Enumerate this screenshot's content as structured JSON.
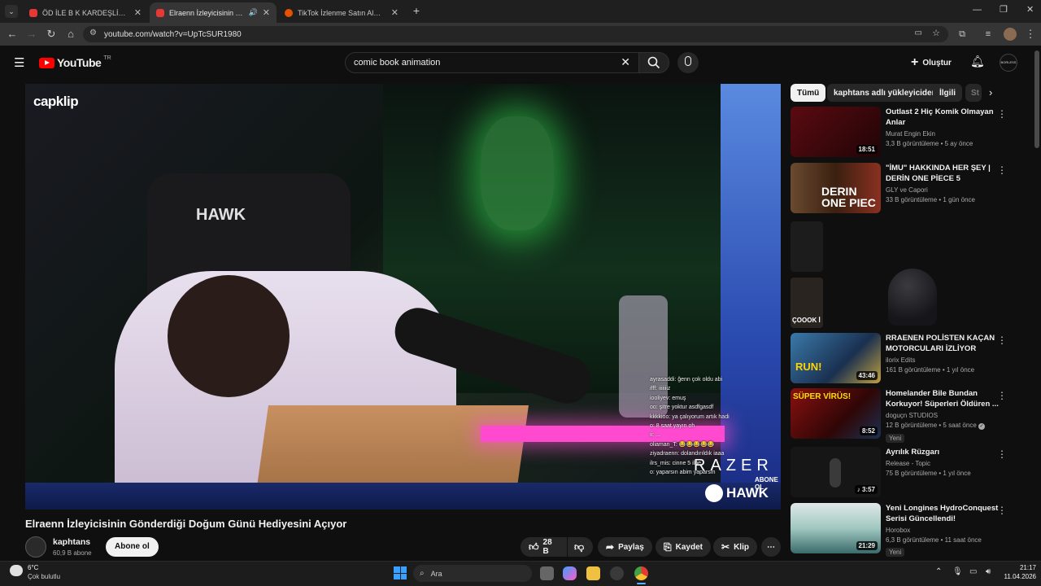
{
  "browser": {
    "tabs": [
      {
        "title": "ÖD İLE B K KARDEŞLİĞİ! OUTLA",
        "active": false,
        "color": "#e53935"
      },
      {
        "title": "Elraenn İzleyicisinin Gönder",
        "active": true,
        "color": "#e53935"
      },
      {
        "title": "TikTok İzlenme Satın Alma Den",
        "active": false,
        "color": "#e65100"
      }
    ],
    "new_tab": "+",
    "url": "youtube.com/watch?v=UpTcSUR1980"
  },
  "youtube": {
    "logo_text": "YouTube",
    "region": "TR",
    "search_value": "comic book animation",
    "create_label": "Oluştur",
    "avatar_text": "BORLESS"
  },
  "video": {
    "title": "Elraenn İzleyicisinin Gönderdiği Doğum Günü Hediyesini Açıyor",
    "channel_name": "kaphtans",
    "subscribers": "60,9 B abone",
    "subscribe_label": "Abone ol",
    "likes": "28 B",
    "share_label": "Paylaş",
    "save_label": "Kaydet",
    "clip_label": "Klip",
    "watermark": "capklip",
    "overlay_brand": "RAZER",
    "overlay_sub": "ABONE OL",
    "chat_lines": [
      "ayrasaddi: ğenn çok oldu abi",
      "ifff: iiiiiiiz",
      "iooliyev: emuş",
      "oo: şitre yoktur asdfgasdf",
      "kkkkioo: ya çalıyorum artık hadi",
      "o: 8 saat yayın oh",
      "ii: ...",
      "oliaman_T: 😂😂😂😂😂",
      "ziyadraenn: dolandırıldık iaaa",
      "ilrs_mis: cinne 5 ilne",
      "o: yaparsın abim yaparsın"
    ]
  },
  "chips": [
    "Tümü",
    "kaphtans adlı yükleyiciden",
    "İlgili",
    "St"
  ],
  "recommendations": [
    {
      "title": "Outlast 2   Hiç Komik Olmayan Anlar",
      "channel": "Murat Engin Ekin",
      "meta": "3,3 B görüntüleme • 5 ay önce",
      "duration": "18:51",
      "badge": "",
      "color": "#3a0a0e"
    },
    {
      "title": "\"İMU\" HAKKINDA HER ŞEY | DERİN ONE PİECE 5",
      "channel": "GLY ve Capori",
      "meta": "33 B görüntüleme • 1 gün önce",
      "duration": "",
      "badge": "",
      "color": "#4a3020"
    },
    {
      "title": "RRAENEN POLİSTEN KAÇAN MOTORCULARI İZLİYOR",
      "channel": "ilorix Edits",
      "meta": "161 B görüntüleme • 1 yıl önce",
      "duration": "43:46",
      "badge": "",
      "color": "#2a5a7a"
    },
    {
      "title": "Homelander Bile Bundan Korkuyor! Süperleri Öldüren ...",
      "channel": "doguçn STUDIOS",
      "meta": "12 B görüntüleme • 5 saat önce",
      "duration": "8:52",
      "badge": "Yeni",
      "color": "#7a1010"
    },
    {
      "title": "Ayrılık Rüzgarı",
      "channel": "Release - Topic",
      "meta": "75 B görüntüleme • 1 yıl önce",
      "duration": "3:57",
      "badge": "",
      "color": "#151515"
    },
    {
      "title": "Yeni Longines HydroConquest Serisi Güncellendi!",
      "channel": "Horobox",
      "meta": "6,3 B görüntüleme • 11 saat önce",
      "duration": "21:29",
      "badge": "Yeni",
      "color": "#3a6a6a"
    }
  ],
  "partial_rec": {
    "thumb_text": "ÇOOOK İ"
  },
  "taskbar": {
    "weather_temp": "6°C",
    "weather_desc": "Çok bulutlu",
    "search_placeholder": "Ara",
    "time": "21:17",
    "date": "11.04.2026"
  }
}
